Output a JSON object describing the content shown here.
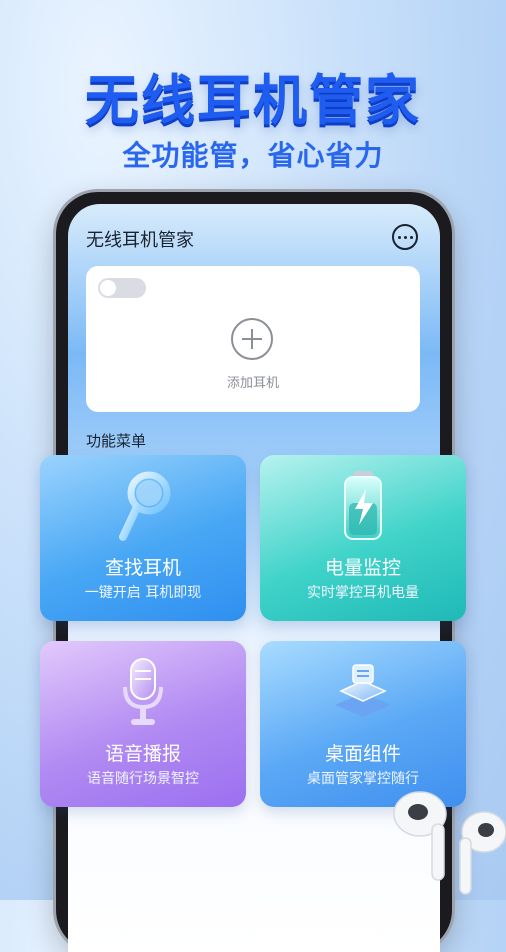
{
  "headline": "无线耳机管家",
  "subline": "全功能管，省心省力",
  "app": {
    "title": "无线耳机管家",
    "more_icon": "more-dots-icon"
  },
  "add_card": {
    "label": "添加耳机",
    "toggle_on": false
  },
  "menu": {
    "label": "功能菜单",
    "tiles": [
      {
        "title": "查找耳机",
        "subtitle": "一键开启 耳机即现",
        "icon": "magnifier-icon"
      },
      {
        "title": "电量监控",
        "subtitle": "实时掌控耳机电量",
        "icon": "battery-icon"
      },
      {
        "title": "语音播报",
        "subtitle": "语音随行场景智控",
        "icon": "microphone-icon"
      },
      {
        "title": "桌面组件",
        "subtitle": "桌面管家掌控随行",
        "icon": "widget-stack-icon"
      }
    ]
  },
  "colors": {
    "headline": "#1f5cf0",
    "find_tile": "#48a7f4",
    "battery_tile": "#3fd3c9",
    "voice_tile": "#b18af2",
    "widget_tile": "#5aa8f5"
  }
}
